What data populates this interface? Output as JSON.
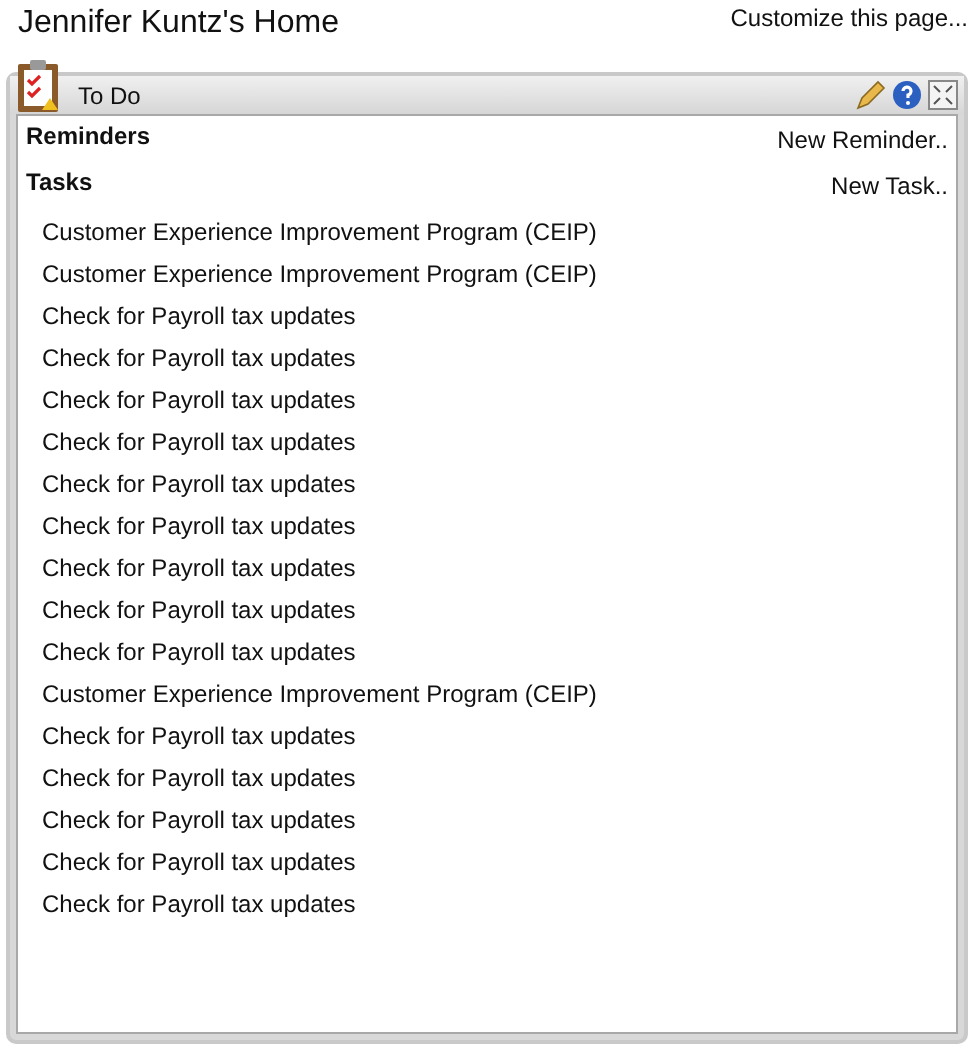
{
  "page": {
    "title": "Jennifer Kuntz's Home",
    "customize_link": "Customize this page..."
  },
  "panel": {
    "title": "To Do",
    "reminders": {
      "heading": "Reminders",
      "action": "New Reminder.."
    },
    "tasks": {
      "heading": "Tasks",
      "action": "New Task..",
      "items": [
        {
          "label": "Customer Experience Improvement Program (CEIP)"
        },
        {
          "label": "Customer Experience Improvement Program (CEIP)"
        },
        {
          "label": "Check for Payroll tax updates"
        },
        {
          "label": "Check for Payroll tax updates"
        },
        {
          "label": "Check for Payroll tax updates"
        },
        {
          "label": "Check for Payroll tax updates"
        },
        {
          "label": "Check for Payroll tax updates"
        },
        {
          "label": "Check for Payroll tax updates"
        },
        {
          "label": "Check for Payroll tax updates"
        },
        {
          "label": "Check for Payroll tax updates"
        },
        {
          "label": "Check for Payroll tax updates"
        },
        {
          "label": "Customer Experience Improvement Program (CEIP)"
        },
        {
          "label": "Check for Payroll tax updates"
        },
        {
          "label": "Check for Payroll tax updates"
        },
        {
          "label": "Check for Payroll tax updates"
        },
        {
          "label": "Check for Payroll tax updates"
        },
        {
          "label": "Check for Payroll tax updates"
        }
      ]
    }
  }
}
